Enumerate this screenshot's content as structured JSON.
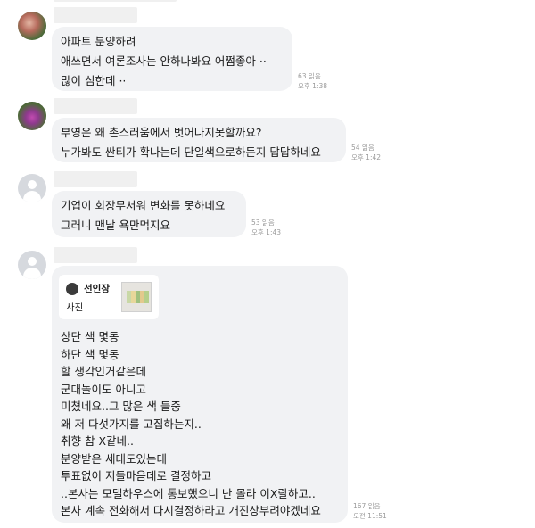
{
  "messages": [
    {
      "lines": [
        "아파트 분양하려",
        "애쓰면서 여론조사는 안하나봐요 어쩜좋아 ··",
        "많이 심한데 ··"
      ],
      "reads": "63 읽음",
      "time": "오후 1:38"
    },
    {
      "lines": [
        "부영은 왜 촌스러움에서 벗어나지못할까요?",
        "누가봐도 싼티가 확나는데 단일색으로하든지 답답하네요"
      ],
      "reads": "54 읽음",
      "time": "오후 1:42"
    },
    {
      "lines": [
        "기업이 회장무서워 변화를 못하네요",
        "그러니 맨날 욕만먹지요"
      ],
      "reads": "53 읽음",
      "time": "오후 1:43"
    },
    {
      "quote": {
        "name": "선인장",
        "type": "사진"
      },
      "lines": [
        "상단 색 몇동",
        "하단 색 몇동",
        "할 생각인거같은데",
        "군대놀이도 아니고",
        "미쳤네요..그 많은 색 들중",
        "왜 저 다섯가지를 고집하는지..",
        "취향 참 X같네..",
        "분양받은 세대도있는데",
        "투표없이 지들마음데로 결정하고",
        "..본사는 모델하우스에 통보했으니 난 몰라 이X랄하고..",
        "본사 계속 전화해서 다시결정하라고 개진상부려야겠네요"
      ],
      "reads": "167 읽음",
      "time": "오전 11:51"
    }
  ],
  "icons": {
    "avatar_1": "profile-photo-icon",
    "avatar_2": "profile-photo-icon",
    "avatar_3": "default-profile-icon",
    "avatar_4": "default-profile-icon"
  },
  "colors": {
    "bubble": "#f1f2f4",
    "meta_text": "#9a9a9a",
    "name_placeholder": "#f0f0f0"
  }
}
